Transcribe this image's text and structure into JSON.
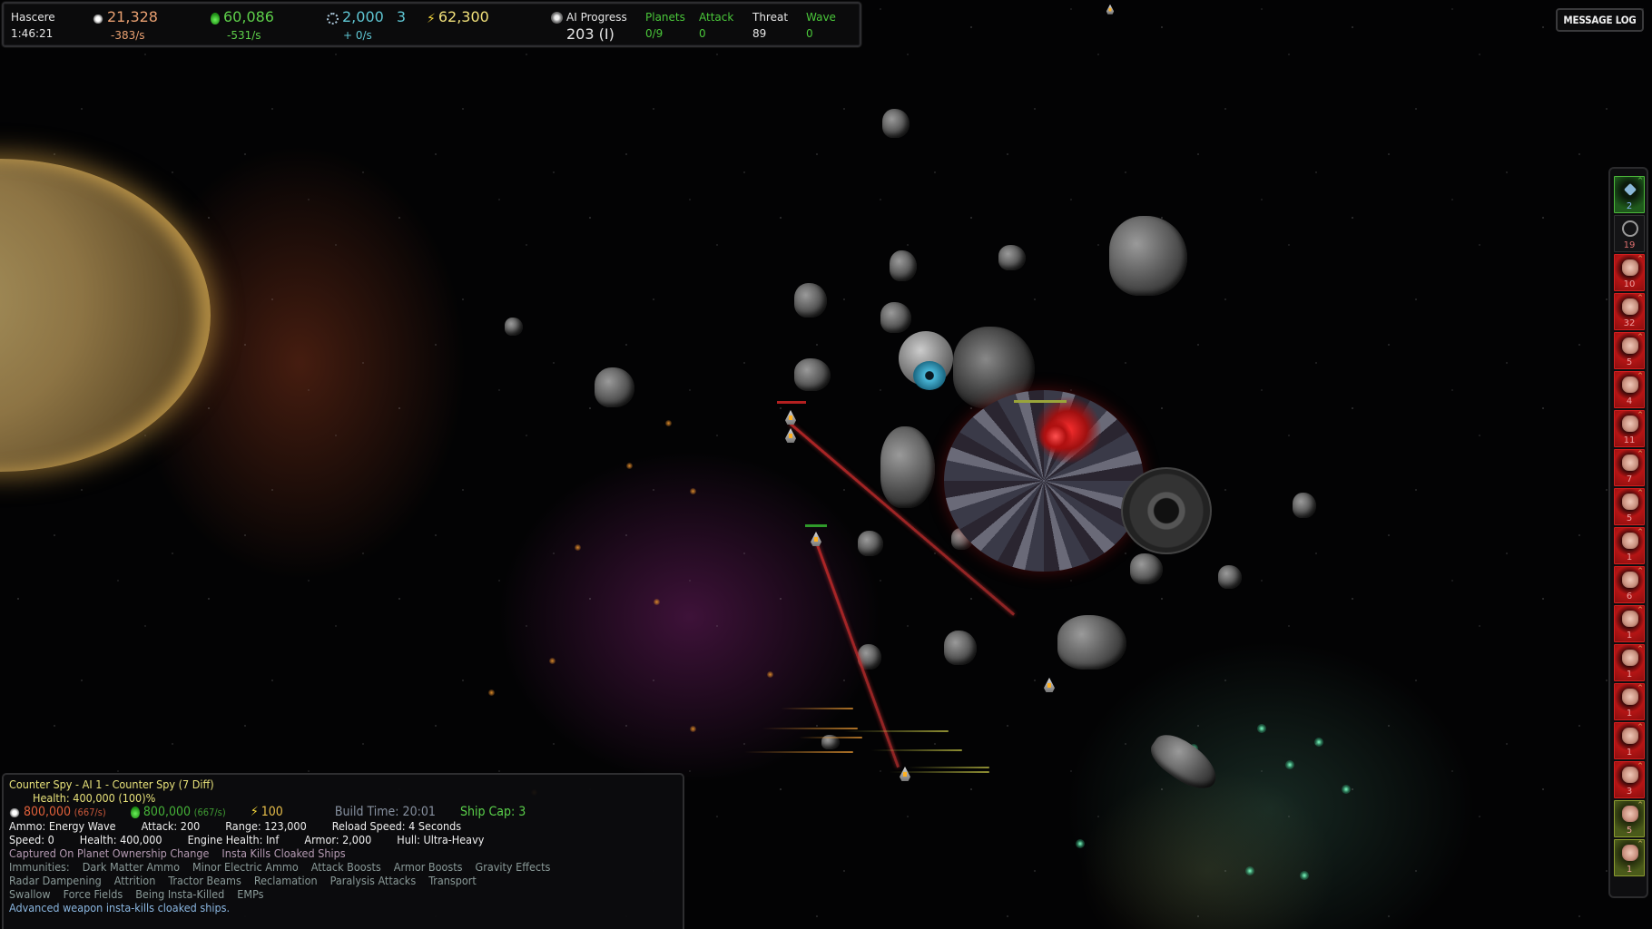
{
  "hud": {
    "player_name": "Hascere",
    "game_time": "1:46:21",
    "metal": {
      "icon": "metal-icon",
      "value": "21,328",
      "rate": "-383/s"
    },
    "crystal": {
      "icon": "crystal-icon",
      "value": "60,086",
      "rate": "-531/s"
    },
    "science": {
      "icon": "science-icon",
      "value": "2,000",
      "rate": "+ 0/s",
      "extra": "3"
    },
    "energy": {
      "icon": "energy-icon",
      "value": "62,300"
    },
    "ai_progress": {
      "icon": "ai-skull-icon",
      "label": "AI Progress",
      "value": "203 (I)"
    },
    "planets": {
      "label": "Planets",
      "value": "0/9"
    },
    "attack": {
      "label": "Attack",
      "value": "0"
    },
    "threat": {
      "label": "Threat",
      "value": "89"
    },
    "wave": {
      "label": "Wave",
      "value": "0"
    }
  },
  "message_log_label": "MESSAGE LOG",
  "unit_bar": {
    "items": [
      {
        "style": "green",
        "count": "2",
        "icon": "scout-icon"
      },
      {
        "style": "gray",
        "count": "19",
        "icon": "ring-icon"
      },
      {
        "style": "red",
        "count": "10",
        "icon": "ship-icon"
      },
      {
        "style": "red",
        "count": "32",
        "icon": "ship-icon"
      },
      {
        "style": "red",
        "count": "5",
        "icon": "ship-icon"
      },
      {
        "style": "red",
        "count": "4",
        "icon": "ship-icon"
      },
      {
        "style": "red",
        "count": "11",
        "icon": "ship-icon"
      },
      {
        "style": "red",
        "count": "7",
        "icon": "ship-icon"
      },
      {
        "style": "red",
        "count": "5",
        "icon": "ship-icon"
      },
      {
        "style": "red",
        "count": "1",
        "icon": "ship-icon"
      },
      {
        "style": "red",
        "count": "6",
        "icon": "ship-icon"
      },
      {
        "style": "red",
        "count": "1",
        "icon": "ship-icon"
      },
      {
        "style": "red",
        "count": "1",
        "icon": "ship-icon"
      },
      {
        "style": "red",
        "count": "1",
        "icon": "ship-icon"
      },
      {
        "style": "red",
        "count": "1",
        "icon": "ship-icon"
      },
      {
        "style": "red",
        "count": "3",
        "icon": "ship-icon"
      },
      {
        "style": "olive",
        "count": "5",
        "icon": "ship-icon"
      },
      {
        "style": "olive",
        "count": "1",
        "icon": "ship-icon"
      }
    ]
  },
  "info_panel": {
    "title": "Counter Spy - AI 1 - Counter Spy (7 Diff)",
    "health_line": "Health:   400,000 (100)%",
    "metal_cost": "800,000",
    "metal_rate": "(667/s)",
    "crystal_cost": "800,000",
    "crystal_rate": "(667/s)",
    "energy_cost": "100",
    "build_time": "Build Time: 20:01",
    "ship_cap": "Ship Cap:   3",
    "stats_row1": [
      "Ammo:   Energy Wave",
      "Attack:  200",
      "Range:   123,000",
      "Reload Speed:   4 Seconds"
    ],
    "stats_row2": [
      "Speed:  0",
      "Health:  400,000",
      "Engine Health:  Inf",
      "Armor:  2,000",
      "Hull:  Ultra-Heavy"
    ],
    "abilities": [
      "Captured On Planet Ownership Change",
      "Insta Kills Cloaked Ships"
    ],
    "immunities_row1": [
      "Immunities:",
      "Dark Matter Ammo",
      "Minor Electric Ammo",
      "Attack Boosts",
      "Armor Boosts",
      "Gravity Effects"
    ],
    "immunities_row2": [
      "Radar Dampening",
      "Attrition",
      "Tractor Beams",
      "Reclamation",
      "Paralysis Attacks",
      "Transport"
    ],
    "immunities_row3": [
      "Swallow",
      "Force Fields",
      "Being Insta-Killed",
      "EMPs"
    ],
    "description": "Advanced weapon insta-kills cloaked ships."
  },
  "colors": {
    "metal": "#e9a071",
    "crystal": "#5ed04a",
    "science": "#5fc7d4",
    "energy": "#f1e07a",
    "hostile": "#b51515",
    "friendly": "#1f5a1c"
  }
}
